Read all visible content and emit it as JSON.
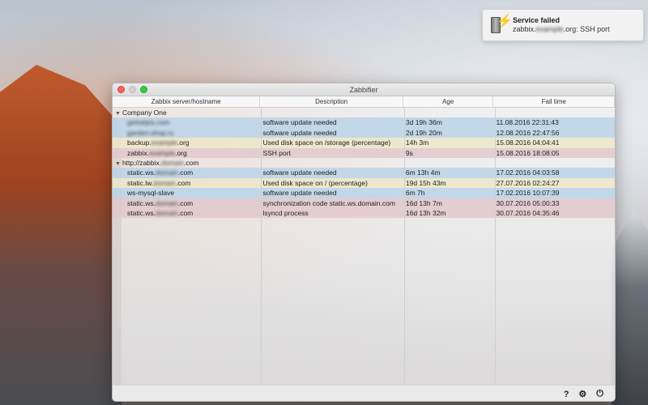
{
  "notification": {
    "title": "Service failed",
    "host_prefix": "zabbix.",
    "host_blurred": "example",
    "message_suffix": ".org: SSH port",
    "icon": "server-lightning-icon"
  },
  "window": {
    "title": "Zabbifier"
  },
  "table": {
    "columns": [
      "Zabbix server/hostname",
      "Description",
      "Age",
      "Fail time"
    ],
    "groups": [
      {
        "name": "Company One",
        "rows": [
          {
            "host_pre": "",
            "host_blur": "geloetjes.com",
            "host_post": "",
            "description": "software update needed",
            "age": "3d 19h 36m",
            "fail_time": "11.08.2016 22:31:43",
            "color": "blue"
          },
          {
            "host_pre": "",
            "host_blur": "garden-shop.ru",
            "host_post": "",
            "description": "software update needed",
            "age": "2d 19h 20m",
            "fail_time": "12.08.2016 22:47:56",
            "color": "blue"
          },
          {
            "host_pre": "backup.",
            "host_blur": "example",
            "host_post": ".org",
            "description": "Used disk space on /storage (percentage)",
            "age": "14h 3m",
            "fail_time": "15.08.2016 04:04:41",
            "color": "yellow"
          },
          {
            "host_pre": "zabbix.",
            "host_blur": "example",
            "host_post": ".org",
            "description": "SSH port",
            "age": "9s",
            "fail_time": "15.08.2016 18:08:05",
            "color": "pink"
          }
        ]
      },
      {
        "name": "http://zabbix.",
        "name_blur": "domain",
        "name_post": ".com",
        "rows": [
          {
            "host_pre": "static.ws.",
            "host_blur": "domain",
            "host_post": ".com",
            "description": "software update needed",
            "age": "6m 13h 4m",
            "fail_time": "17.02.2016 04:03:58",
            "color": "blue"
          },
          {
            "host_pre": "static.lw.",
            "host_blur": "domain",
            "host_post": ".com",
            "description": "Used disk space on / (percentage)",
            "age": "19d 15h 43m",
            "fail_time": "27.07.2016 02:24:27",
            "color": "yellow"
          },
          {
            "host_pre": "ws-mysql-slave",
            "host_blur": "",
            "host_post": "",
            "description": "software update needed",
            "age": "6m 7h",
            "fail_time": "17.02.2016 10:07:39",
            "color": "blue"
          },
          {
            "host_pre": "static.ws.",
            "host_blur": "domain",
            "host_post": ".com",
            "description": "synchronization code static.ws.domain.com",
            "age": "16d 13h 7m",
            "fail_time": "30.07.2016 05:00:33",
            "color": "pink"
          },
          {
            "host_pre": "static.ws.",
            "host_blur": "domain",
            "host_post": ".com",
            "description": "lsyncd process",
            "age": "16d 13h 32m",
            "fail_time": "30.07.2016 04:35:46",
            "color": "pink"
          }
        ]
      }
    ]
  },
  "footer": {
    "help_label": "?",
    "settings_label": "⚙",
    "power_label": "⏻"
  }
}
